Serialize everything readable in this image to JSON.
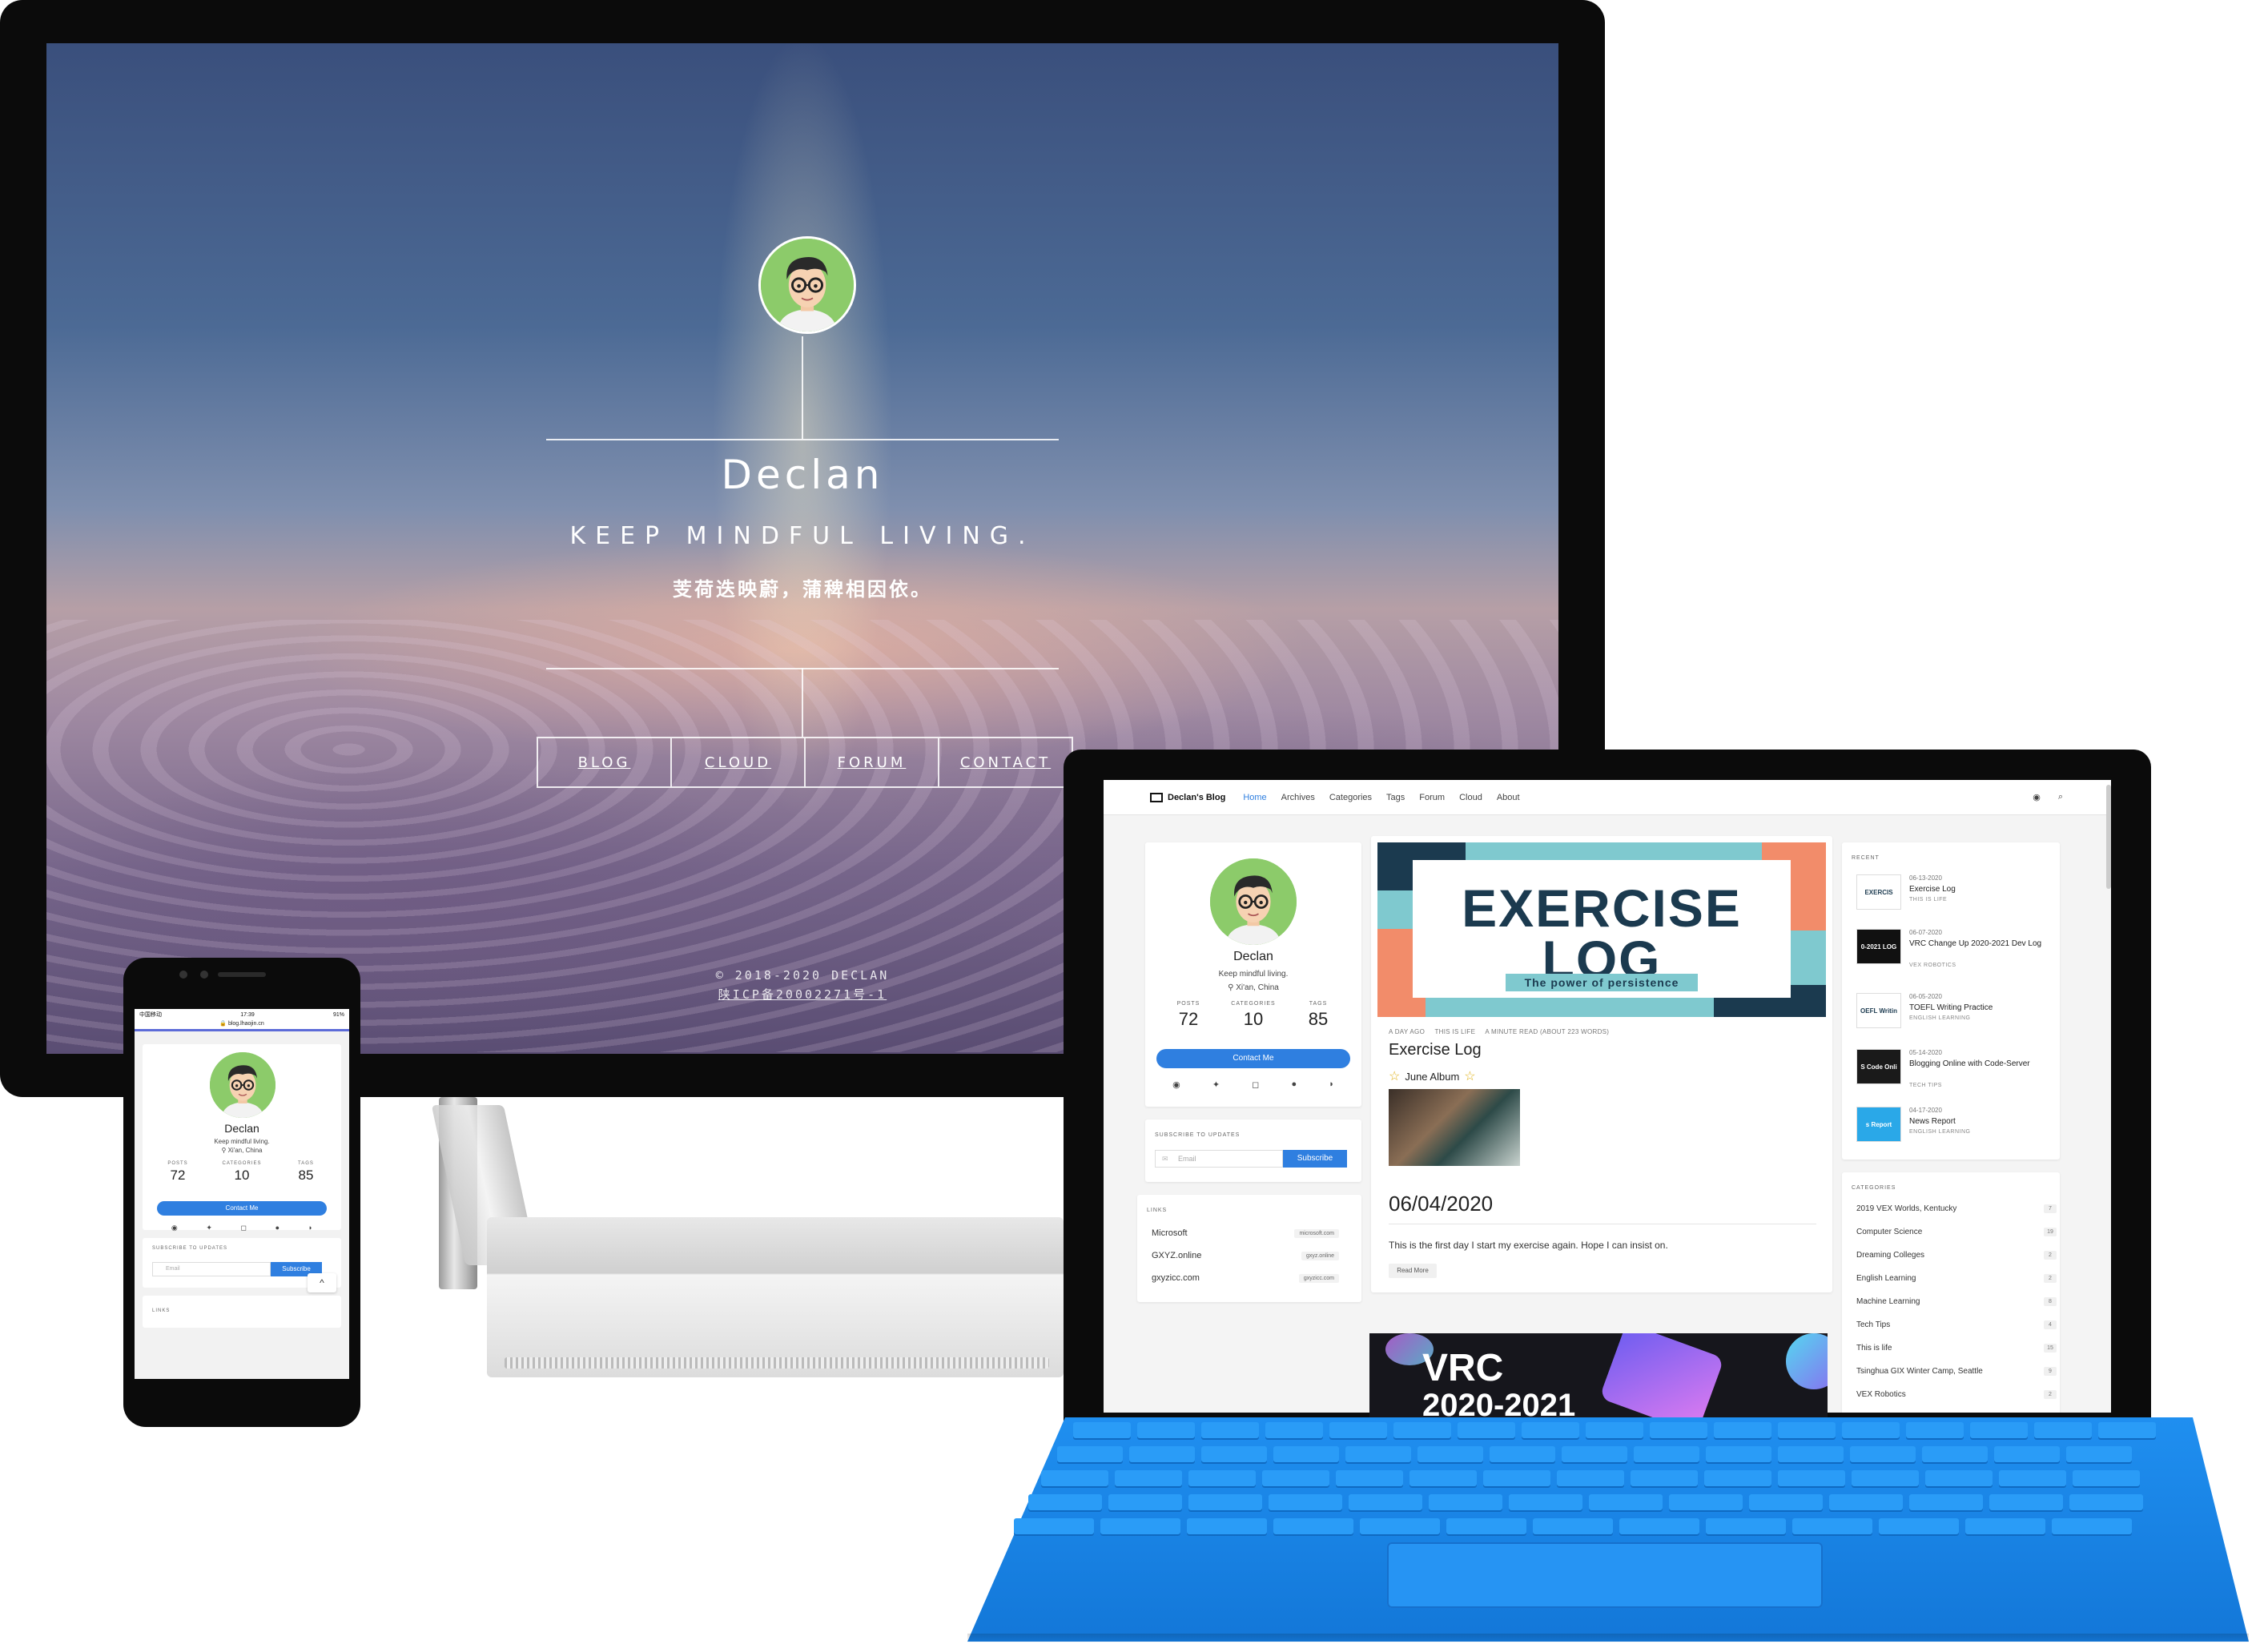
{
  "desktop": {
    "name": "Declan",
    "tagline": "KEEP MINDFUL LIVING.",
    "chinese_line": "芰荷迭映蔚，蒲稗相因依。",
    "nav": [
      {
        "label": "BLOG"
      },
      {
        "label": "CLOUD"
      },
      {
        "label": "FORUM"
      },
      {
        "label": "CONTACT"
      }
    ],
    "footer_copyright": "© 2018-2020 DECLAN",
    "footer_icp": "陕ICP备20002271号-1"
  },
  "phone": {
    "status_left": "中国移动",
    "status_time": "17:39",
    "status_right": "91%",
    "url": "blog.lhaojin.cn",
    "name": "Declan",
    "desc": "Keep mindful living.",
    "location": "Xi'an, China",
    "stats": [
      {
        "label": "POSTS",
        "value": "72"
      },
      {
        "label": "CATEGORIES",
        "value": "10"
      },
      {
        "label": "TAGS",
        "value": "85"
      }
    ],
    "contact_label": "Contact Me",
    "subscribe_title": "SUBSCRIBE TO UPDATES",
    "email_placeholder": "Email",
    "subscribe_label": "Subscribe",
    "links_title": "LINKS",
    "back_to_top": "^"
  },
  "tablet": {
    "brand": "Declan's Blog",
    "nav": [
      {
        "label": "Home",
        "active": true
      },
      {
        "label": "Archives"
      },
      {
        "label": "Categories"
      },
      {
        "label": "Tags"
      },
      {
        "label": "Forum"
      },
      {
        "label": "Cloud"
      },
      {
        "label": "About"
      }
    ],
    "profile": {
      "name": "Declan",
      "desc": "Keep mindful living.",
      "location": "Xi'an, China",
      "stats": [
        {
          "label": "POSTS",
          "value": "72"
        },
        {
          "label": "CATEGORIES",
          "value": "10"
        },
        {
          "label": "TAGS",
          "value": "85"
        }
      ],
      "contact_label": "Contact Me"
    },
    "subscribe": {
      "title": "SUBSCRIBE TO UPDATES",
      "placeholder": "Email",
      "button": "Subscribe"
    },
    "links": {
      "title": "LINKS",
      "items": [
        {
          "name": "Microsoft",
          "url": "microsoft.com"
        },
        {
          "name": "GXYZ.online",
          "url": "gxyz.online"
        },
        {
          "name": "gxyzicc.com",
          "url": "gxyzicc.com"
        }
      ]
    },
    "post": {
      "hero_line1": "EXERCISE",
      "hero_line2": "LOG",
      "hero_slogan": "The power of persistence",
      "meta": [
        "A DAY AGO",
        "THIS IS LIFE",
        "A MINUTE READ (ABOUT 223 WORDS)"
      ],
      "title": "Exercise Log",
      "album": "June Album",
      "date": "06/04/2020",
      "excerpt": "This is the first day I start my exercise again. Hope I can insist on.",
      "read_more": "Read More"
    },
    "next_post": {
      "hero_line1": "VRC",
      "hero_line2": "2020-2021"
    },
    "recent": {
      "title": "RECENT",
      "items": [
        {
          "date": "06-13-2020",
          "title": "Exercise Log",
          "category": "THIS IS LIFE",
          "thumb": "EXERCIS LOG"
        },
        {
          "date": "06-07-2020",
          "title": "VRC Change Up 2020-2021 Dev Log",
          "category": "VEX ROBOTICS",
          "thumb": "0-2021 LOG"
        },
        {
          "date": "06-05-2020",
          "title": "TOEFL Writing Practice",
          "category": "ENGLISH LEARNING",
          "thumb": "OEFL Writin Practice"
        },
        {
          "date": "05-14-2020",
          "title": "Blogging Online with Code-Server",
          "category": "TECH TIPS",
          "thumb": "S Code Onli"
        },
        {
          "date": "04-17-2020",
          "title": "News Report",
          "category": "ENGLISH LEARNING",
          "thumb": "s Report"
        }
      ]
    },
    "categories": {
      "title": "CATEGORIES",
      "items": [
        {
          "name": "2019 VEX Worlds, Kentucky",
          "count": "7"
        },
        {
          "name": "Computer Science",
          "count": "19"
        },
        {
          "name": "Dreaming Colleges",
          "count": "2"
        },
        {
          "name": "English Learning",
          "count": "2"
        },
        {
          "name": "Machine Learning",
          "count": "8"
        },
        {
          "name": "Tech Tips",
          "count": "4"
        },
        {
          "name": "This is life",
          "count": "15"
        },
        {
          "name": "Tsinghua GIX Winter Camp, Seattle",
          "count": "9"
        },
        {
          "name": "VEX Robotics",
          "count": "2"
        }
      ]
    }
  },
  "colors": {
    "accent": "#2f7fe0",
    "keyboard": "#1f8ff0",
    "hero_teal": "#7fc9cf",
    "hero_navy": "#1b3a4f",
    "hero_coral": "#f28c6a",
    "avatar_green": "#8ccb6a"
  },
  "icons": [
    "github-icon",
    "twitter-icon",
    "instagram-icon",
    "qq-icon",
    "rss-icon",
    "search-icon",
    "location-pin-icon",
    "email-icon",
    "star-icon"
  ]
}
